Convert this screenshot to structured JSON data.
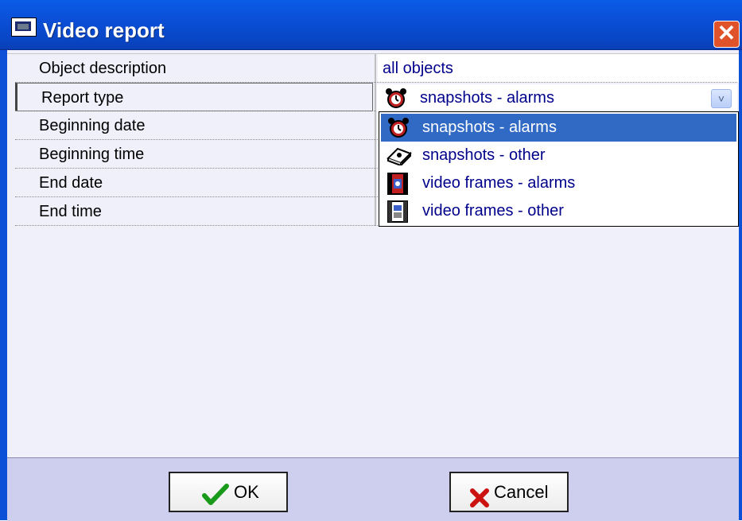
{
  "window": {
    "title": "Video report",
    "close_glyph": "✕"
  },
  "properties": [
    {
      "label": "Object description",
      "value": "all objects"
    },
    {
      "label": "Report type",
      "value": ""
    },
    {
      "label": "Beginning date",
      "value": ""
    },
    {
      "label": "Beginning time",
      "value": ""
    },
    {
      "label": "End date",
      "value": ""
    },
    {
      "label": "End time",
      "value": ""
    }
  ],
  "report_type": {
    "selected": "snapshots - alarms",
    "selected_icon": "alarm-clock-icon",
    "options": [
      {
        "label": "snapshots - alarms",
        "icon": "alarm-clock-icon",
        "highlighted": true
      },
      {
        "label": "snapshots - other",
        "icon": "camera-snapshot-icon",
        "highlighted": false
      },
      {
        "label": "video frames - alarms",
        "icon": "film-alarm-icon",
        "highlighted": false
      },
      {
        "label": "video frames - other",
        "icon": "film-other-icon",
        "highlighted": false
      }
    ]
  },
  "buttons": {
    "ok": "OK",
    "cancel": "Cancel"
  },
  "colors": {
    "titlebar": "#0b4fd6",
    "selection": "#316ac5",
    "value_text": "#00008b",
    "button_bar": "#ceceef"
  }
}
